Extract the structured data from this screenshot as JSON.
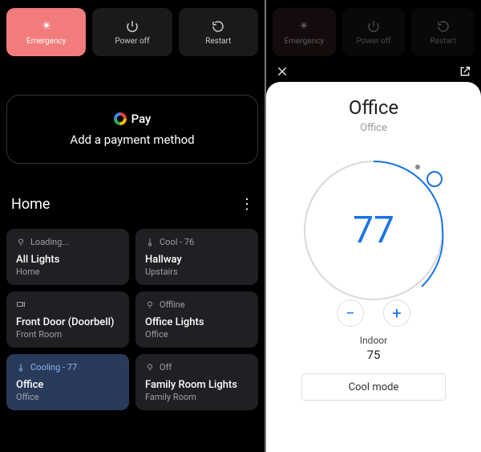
{
  "power_row": {
    "emergency": "Emergency",
    "power_off": "Power off",
    "restart": "Restart"
  },
  "gpay": {
    "brand": "Pay",
    "caption": "Add a payment method"
  },
  "home": {
    "title": "Home"
  },
  "tiles": [
    {
      "status": "Loading...",
      "name": "All Lights",
      "room": "Home",
      "icon": "bulb",
      "active": false
    },
    {
      "status": "Cool - 76",
      "name": "Hallway",
      "room": "Upstairs",
      "icon": "thermo",
      "active": false
    },
    {
      "status": "",
      "name": "Front Door (Doorbell)",
      "room": "Front Room",
      "icon": "camera",
      "active": false
    },
    {
      "status": "Offline",
      "name": "Office Lights",
      "room": "Office",
      "icon": "bulb",
      "active": false
    },
    {
      "status": "Cooling - 77",
      "name": "Office",
      "room": "Office",
      "icon": "thermo",
      "active": true
    },
    {
      "status": "Off",
      "name": "Family Room Lights",
      "room": "Family Room",
      "icon": "bulb",
      "active": false
    }
  ],
  "thermostat": {
    "title": "Office",
    "subtitle": "Office",
    "setpoint": "77",
    "indoor_label": "Indoor",
    "indoor_value": "75",
    "mode_label": "Cool mode",
    "dial_color": "#1a73e8"
  }
}
